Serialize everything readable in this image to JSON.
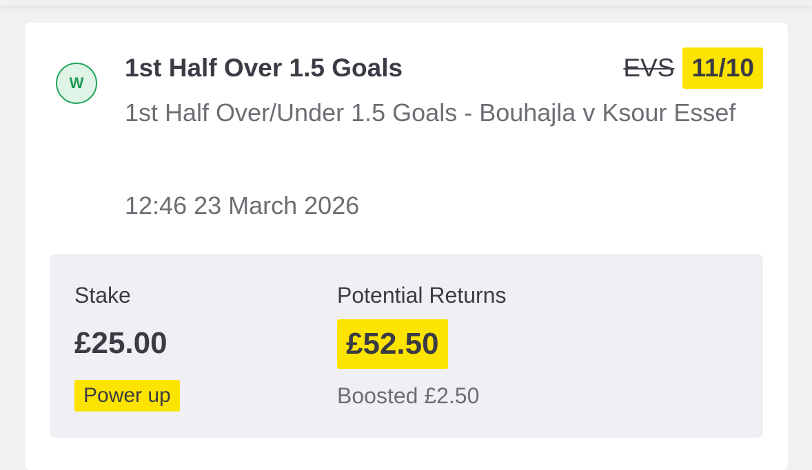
{
  "bet": {
    "status_badge": "W",
    "selection": "1st Half Over 1.5 Goals",
    "old_odds": "EVS",
    "new_odds": "11/10",
    "market_description": "1st Half Over/Under 1.5 Goals - Bouhajla v Ksour Essef",
    "datetime": "12:46 23 March 2026"
  },
  "stake_panel": {
    "stake_label": "Stake",
    "stake_value": "£25.00",
    "power_up_label": "Power up",
    "returns_label": "Potential Returns",
    "returns_value": "£52.50",
    "boosted_text": "Boosted £2.50"
  },
  "colors": {
    "highlight": "#fce400",
    "win_green": "#22a45d",
    "text_dark": "#3b3b45",
    "text_muted": "#6d6d74",
    "panel_bg": "#efeff4"
  }
}
